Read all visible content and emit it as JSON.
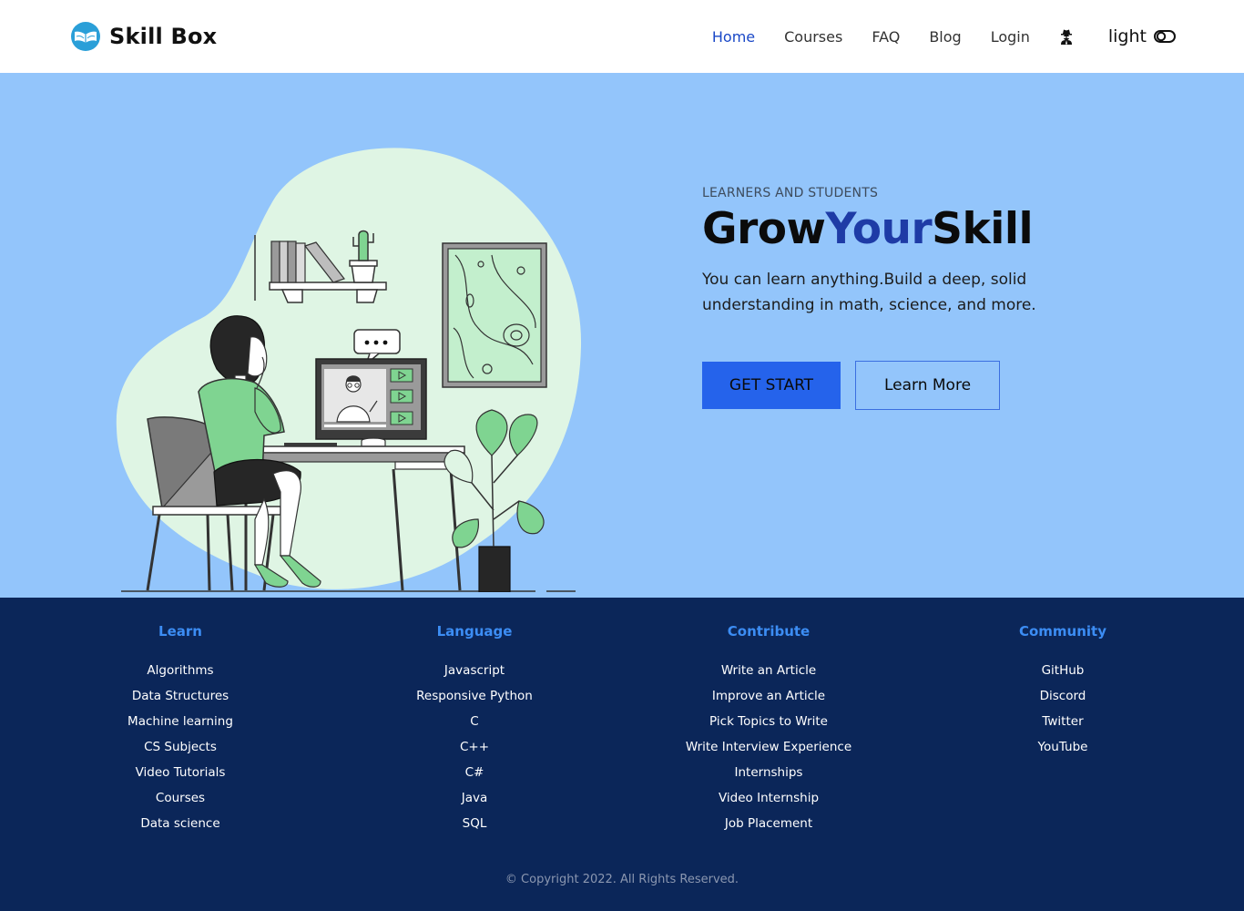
{
  "header": {
    "brand_name": "Skill Box",
    "nav": [
      "Home",
      "Courses",
      "FAQ",
      "Blog",
      "Login"
    ],
    "profile_icon": "user-secret-icon",
    "theme_label": "light"
  },
  "hero": {
    "eyebrow": "LEARNERS AND STUDENTS",
    "title_part1": "Grow",
    "title_part2": "Your",
    "title_part3": "Skill",
    "description": "You can learn anything.Build a deep, solid understanding in math, science, and more.",
    "primary_button": "GET START",
    "secondary_button": "Learn More",
    "illustration": "woman-online-learning-illustration"
  },
  "footer": {
    "columns": [
      {
        "title": "Learn",
        "links": [
          "Algorithms",
          "Data Structures",
          "Machine learning",
          "CS Subjects",
          "Video Tutorials",
          "Courses",
          "Data science"
        ]
      },
      {
        "title": "Language",
        "links": [
          "Javascript",
          "Responsive Python",
          "C",
          "C++",
          "C#",
          "Java",
          "SQL"
        ]
      },
      {
        "title": "Contribute",
        "links": [
          "Write an Article",
          "Improve an Article",
          "Pick Topics to Write",
          "Write Interview Experience",
          "Internships",
          "Video Internship",
          "Job Placement"
        ]
      },
      {
        "title": "Community",
        "links": [
          "GitHub",
          "Discord",
          "Twitter",
          "YouTube"
        ]
      }
    ],
    "copyright": "© Copyright 2022. All Rights Reserved."
  },
  "colors": {
    "accent": "#2563eb",
    "hero_bg": "#93c5fb",
    "footer_bg": "#0b2659",
    "footer_heading": "#3c8df4",
    "title_accent": "#1e3ba6"
  }
}
